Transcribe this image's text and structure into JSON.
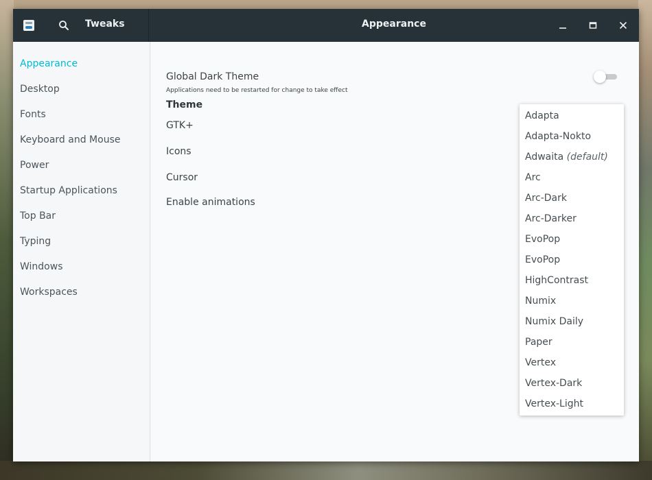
{
  "colors": {
    "headerbar": "#263238",
    "accent": "#00bcd4",
    "sidebar_bg": "#f6f7f9",
    "content_bg": "#f9fafb",
    "text": "#3b4346"
  },
  "header": {
    "app_icon": "tweaks-app-icon",
    "search_icon": "search-icon",
    "app_title": "Tweaks",
    "page_title": "Appearance",
    "window_controls": [
      "minimize-icon",
      "maximize-icon",
      "close-icon"
    ]
  },
  "sidebar": {
    "items": [
      {
        "label": "Appearance",
        "active": true
      },
      {
        "label": "Desktop"
      },
      {
        "label": "Fonts"
      },
      {
        "label": "Keyboard and Mouse"
      },
      {
        "label": "Power"
      },
      {
        "label": "Startup Applications"
      },
      {
        "label": "Top Bar"
      },
      {
        "label": "Typing"
      },
      {
        "label": "Windows"
      },
      {
        "label": "Workspaces"
      }
    ]
  },
  "content": {
    "global_dark_theme": "Global Dark Theme",
    "global_dark_note": "Applications need to be restarted for change to take effect",
    "global_dark_enabled": false,
    "theme_heading": "Theme",
    "gtk_label": "GTK+",
    "icons_label": "Icons",
    "cursor_label": "Cursor",
    "animations_label": "Enable animations"
  },
  "theme_popover": {
    "options": [
      {
        "label": "Adapta"
      },
      {
        "label": "Adapta-Nokto"
      },
      {
        "label": "Adwaita",
        "suffix": "(default)"
      },
      {
        "label": "Arc"
      },
      {
        "label": "Arc-Dark"
      },
      {
        "label": "Arc-Darker"
      },
      {
        "label": "EvoPop"
      },
      {
        "label": "EvoPop"
      },
      {
        "label": "HighContrast"
      },
      {
        "label": "Numix"
      },
      {
        "label": "Numix Daily"
      },
      {
        "label": "Paper"
      },
      {
        "label": "Vertex"
      },
      {
        "label": "Vertex-Dark"
      },
      {
        "label": "Vertex-Light"
      }
    ]
  }
}
